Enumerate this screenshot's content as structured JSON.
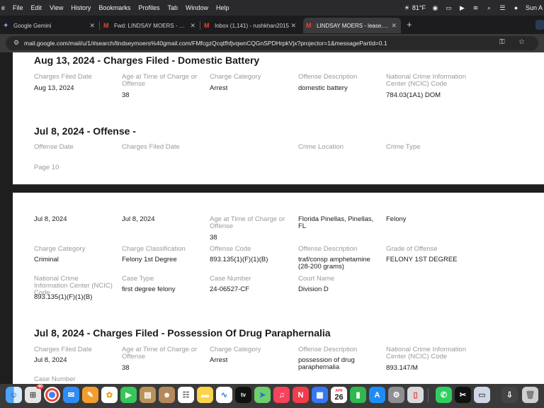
{
  "menubar": {
    "items": [
      "e",
      "File",
      "Edit",
      "View",
      "History",
      "Bookmarks",
      "Profiles",
      "Tab",
      "Window",
      "Help"
    ],
    "weather": "81°F",
    "clock": "Sun A"
  },
  "tabs": [
    {
      "title": "Google Gemini",
      "icon": "gemini-icon"
    },
    {
      "title": "Fwd: LINDSAY MOERS - Def",
      "icon": "gmail-icon"
    },
    {
      "title": "Inbox (1,141) - rushkhan2015",
      "icon": "gmail-icon"
    },
    {
      "title": "LINDSAY MOERS - lease.rep",
      "icon": "gmail-icon"
    }
  ],
  "address": {
    "url": "mail.google.com/mail/u/1/#search/lindseymoers%40gmail.com/FMfcgzQcqtfhfjvqwnCQGnSPDHrpkVjx?projector=1&messagePartId=0.1"
  },
  "record1": {
    "heading": "Aug 13, 2024 - Charges Filed - Domestic Battery",
    "labels": [
      "Charges Filed Date",
      "Age at Time of Charge or Offense",
      "Charge Category",
      "Offense Description",
      "National Crime Information Center (NCIC) Code"
    ],
    "values": [
      "Aug 13, 2024",
      "38",
      "Arrest",
      "domestic battery",
      "784.03(1A1) DOM"
    ]
  },
  "record2": {
    "heading": "Jul 8, 2024 - Offense -",
    "labels": [
      "Offense Date",
      "Charges Filed Date",
      "Crime Location",
      "Crime Type"
    ],
    "page_label": "Page 10"
  },
  "record2_cont": {
    "row1": [
      "Jul 8, 2024",
      "Jul 8, 2024",
      "Age at Time of Charge or Offense",
      "38",
      "Florida Pinellas, Pinellas, FL",
      "Felony"
    ],
    "row2_labels": [
      "Charge Category",
      "Charge Classification",
      "Offense Code",
      "Offense Description",
      "Grade of Offense"
    ],
    "row2_values": [
      "Criminal",
      "Felony 1st Degree",
      "893.135(1)(F)(1)(B)",
      "traf/consp amphetamine (28-200 grams)",
      "FELONY 1ST DEGREE"
    ],
    "row3_labels": [
      "National Crime Information Center (NCIC) Code",
      "Case Type",
      "Case Number",
      "Court Name"
    ],
    "row3_values": [
      "893.135(1)(F)(1)(B)",
      "first degree felony",
      "24-06527-CF",
      "Division D"
    ]
  },
  "record3": {
    "heading": "Jul 8, 2024 - Charges Filed - Possession Of Drug Paraphernalia",
    "labels": [
      "Charges Filed Date",
      "Age at Time of Charge or Offense",
      "Charge Category",
      "Offense Description",
      "National Crime Information Center (NCIC) Code"
    ],
    "values": [
      "Jul 8, 2024",
      "38",
      "Arrest",
      "possession of drug paraphernalia",
      "893.147/M"
    ],
    "next_label": "Case Number"
  },
  "dock": {
    "calendar_month": "APR",
    "calendar_day": "26",
    "mail_badge": "40"
  }
}
